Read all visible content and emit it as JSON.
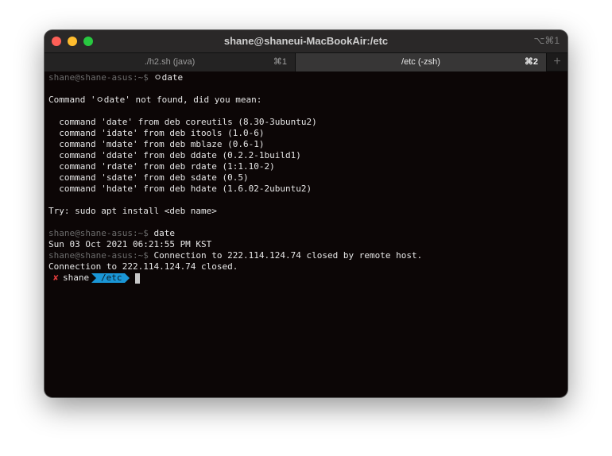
{
  "window": {
    "title": "shane@shaneui-MacBookAir:/etc",
    "title_shortcut": "⌥⌘1"
  },
  "tabs": [
    {
      "label": "./h2.sh (java)",
      "shortcut": "⌘1"
    },
    {
      "label": "/etc (-zsh)",
      "shortcut": "⌘2"
    }
  ],
  "new_tab_glyph": "+",
  "terminal": {
    "lines": [
      {
        "prompt": "shane@shane-asus:~$ ",
        "text": "ㅇdate"
      },
      {
        "prompt": "",
        "text": ""
      },
      {
        "prompt": "",
        "text": "Command 'ㅇdate' not found, did you mean:"
      },
      {
        "prompt": "",
        "text": ""
      },
      {
        "prompt": "",
        "text": "  command 'date' from deb coreutils (8.30-3ubuntu2)"
      },
      {
        "prompt": "",
        "text": "  command 'idate' from deb itools (1.0-6)"
      },
      {
        "prompt": "",
        "text": "  command 'mdate' from deb mblaze (0.6-1)"
      },
      {
        "prompt": "",
        "text": "  command 'ddate' from deb ddate (0.2.2-1build1)"
      },
      {
        "prompt": "",
        "text": "  command 'rdate' from deb rdate (1:1.10-2)"
      },
      {
        "prompt": "",
        "text": "  command 'sdate' from deb sdate (0.5)"
      },
      {
        "prompt": "",
        "text": "  command 'hdate' from deb hdate (1.6.02-2ubuntu2)"
      },
      {
        "prompt": "",
        "text": ""
      },
      {
        "prompt": "",
        "text": "Try: sudo apt install <deb name>"
      },
      {
        "prompt": "",
        "text": ""
      },
      {
        "prompt": "shane@shane-asus:~$ ",
        "text": "date"
      },
      {
        "prompt": "",
        "text": "Sun 03 Oct 2021 06:21:55 PM KST"
      },
      {
        "prompt": "shane@shane-asus:~$ ",
        "text": "Connection to 222.114.124.74 closed by remote host."
      },
      {
        "prompt": "",
        "text": "Connection to 222.114.124.74 closed."
      }
    ],
    "powerline": {
      "status_glyph": "✘",
      "user": "shane",
      "path": "/etc"
    }
  },
  "colors": {
    "background": "#0c0606",
    "prompt": "#6b6b6b",
    "powerline_path_bg": "#1a96d6",
    "error_x": "#e03c3c"
  }
}
